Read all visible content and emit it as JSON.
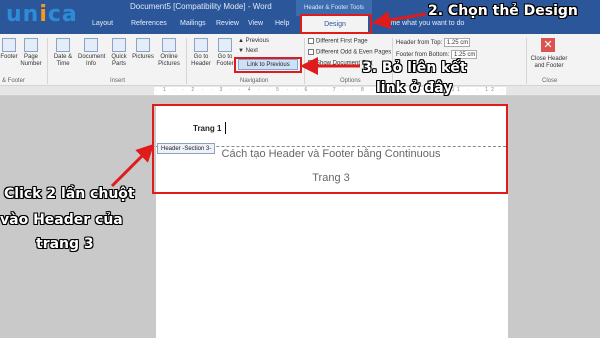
{
  "window": {
    "title": "Document5 [Compatibility Mode] - Word",
    "contextual_tab_title": "Header & Footer Tools"
  },
  "logo": {
    "text_a": "un",
    "text_o": "i",
    "text_b": "ca"
  },
  "tabs": [
    {
      "label": "Layout"
    },
    {
      "label": "References"
    },
    {
      "label": "Mailings"
    },
    {
      "label": "Review"
    },
    {
      "label": "View"
    },
    {
      "label": "Help"
    },
    {
      "label": "Design"
    }
  ],
  "tell_me": "Tell me what you want to do",
  "ribbon": {
    "insert_buttons": [
      {
        "label": "Footer"
      },
      {
        "label": "Page Number"
      },
      {
        "label": "Date & Time"
      },
      {
        "label": "Document Info"
      },
      {
        "label": "Quick Parts"
      },
      {
        "label": "Pictures"
      },
      {
        "label": "Online Pictures"
      }
    ],
    "goto_buttons": [
      {
        "label": "Go to Header"
      },
      {
        "label": "Go to Footer"
      }
    ],
    "nav_small": {
      "previous": "Previous",
      "next": "Next"
    },
    "link_to_previous": "Link to Previous",
    "options": [
      {
        "label": "Different First Page",
        "checked": false
      },
      {
        "label": "Different Odd & Even Pages",
        "checked": false
      },
      {
        "label": "Show Document Text",
        "checked": true
      }
    ],
    "position": {
      "header_from_top_label": "Header from Top:",
      "header_from_top_value": "1.25 cm",
      "footer_from_bottom_label": "Footer from Bottom:",
      "footer_from_bottom_value": "1.25 cm"
    },
    "close_label": "Close Header and Footer",
    "groups": {
      "header_footer": "& Footer",
      "insert": "Insert",
      "navigation": "Navigation",
      "options": "Options",
      "close": "Close"
    }
  },
  "document": {
    "header_text": "Trang 1",
    "header_tag": "Header -Section 3-",
    "heading": "Cách tạo Header và Footer bằng Continuous",
    "page_label": "Trang 3"
  },
  "annotations": {
    "step2": "2. Chọn thẻ Design",
    "step3_line1": "3. Bỏ liên kết",
    "step3_line2": "link ở đây",
    "step1_line1": "Click 2 lần chuột",
    "step1_line2": "vào Header của",
    "step1_line3": "trang 3"
  },
  "colors": {
    "word_blue": "#2b579a",
    "highlight_red": "#e01b1b",
    "logo_blue": "#2d8cd8",
    "logo_orange": "#f29a1d"
  }
}
